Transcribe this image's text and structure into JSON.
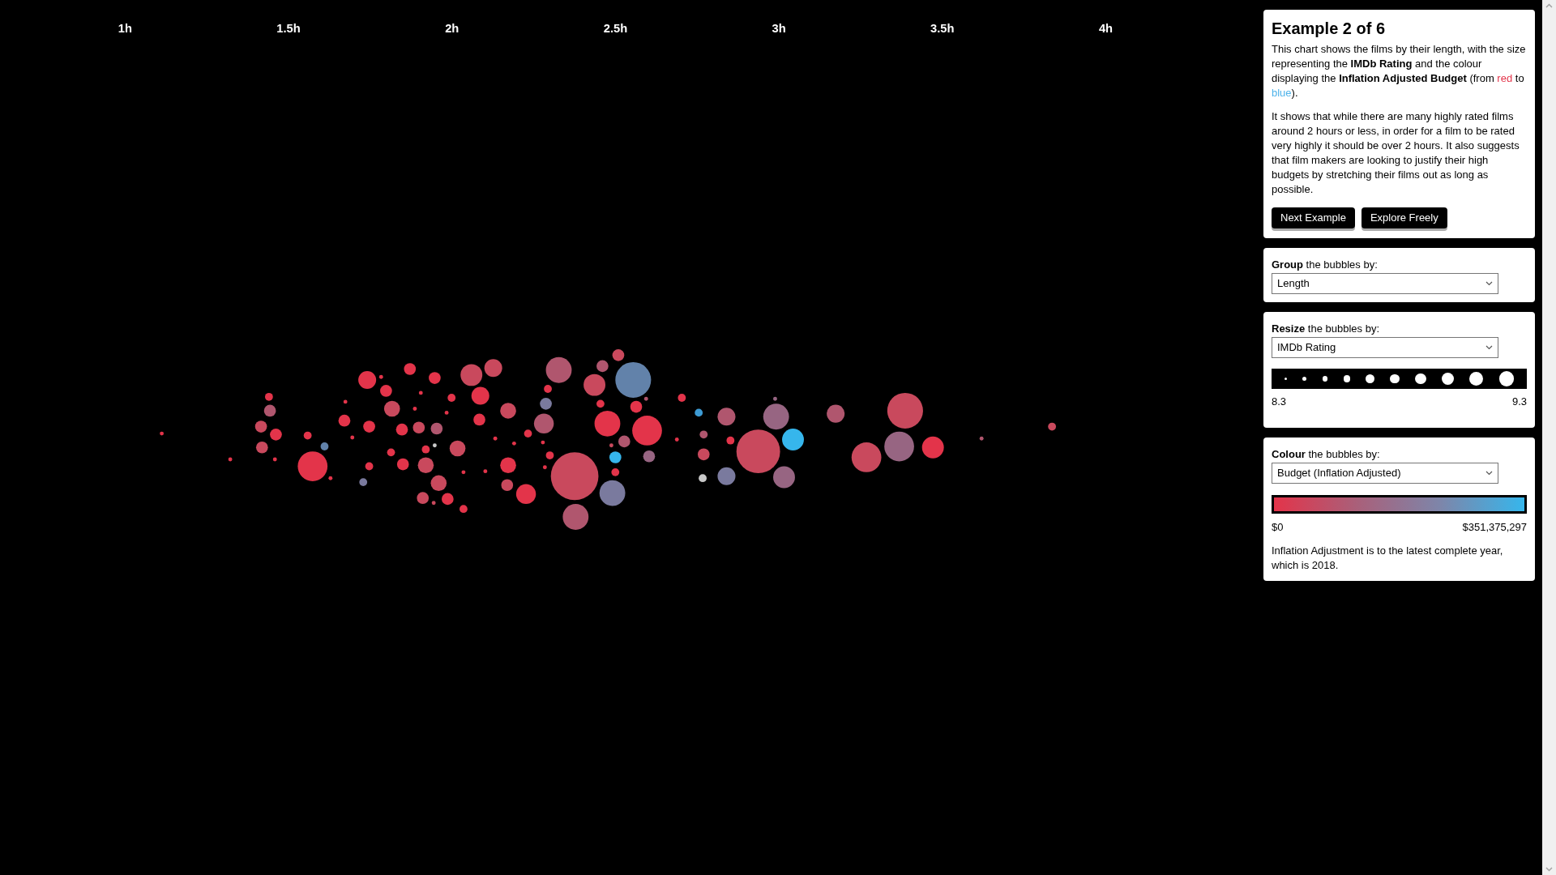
{
  "chart": {
    "axis_labels": [
      "1h",
      "1.5h",
      "2h",
      "2.5h",
      "3h",
      "3.5h",
      "4h"
    ]
  },
  "intro": {
    "title": "Example 2 of 6",
    "paragraph_1": [
      {
        "text": "This chart shows the films by their length, with the size representing the **IMDb Rating** and the colour displaying the **Inflation Adjusted Budget** (from "
      },
      {
        "text": "red",
        "color": "#e3344a"
      },
      {
        "text": " to "
      },
      {
        "text": "blue",
        "color": "#4fb3ea"
      },
      {
        "text": ")."
      }
    ],
    "paragraph_2": "It shows that while there are many highly rated films around 2 hours or less, in order for a film to be rated very highly it should be over 2 hours. It also suggests that film makers are looking to justify their high budgets by stretching their films out as long as possible.",
    "buttons": [
      "Next Example",
      "Explore Freely"
    ]
  },
  "controls": [
    {
      "kind": "group",
      "label": "**Group** the bubbles by:",
      "value": "Length"
    },
    {
      "kind": "size",
      "label": "**Resize** the bubbles by:",
      "value": "IMDb Rating",
      "legend_min": "8.3",
      "legend_max": "9.3"
    },
    {
      "kind": "colour",
      "label": "**Colour** the bubbles by:",
      "value": "Budget (Inflation Adjusted)",
      "legend_min": "$0",
      "legend_max": "$351,375,297",
      "note": "Inflation Adjustment is to the latest complete year, which is 2018."
    }
  ]
}
